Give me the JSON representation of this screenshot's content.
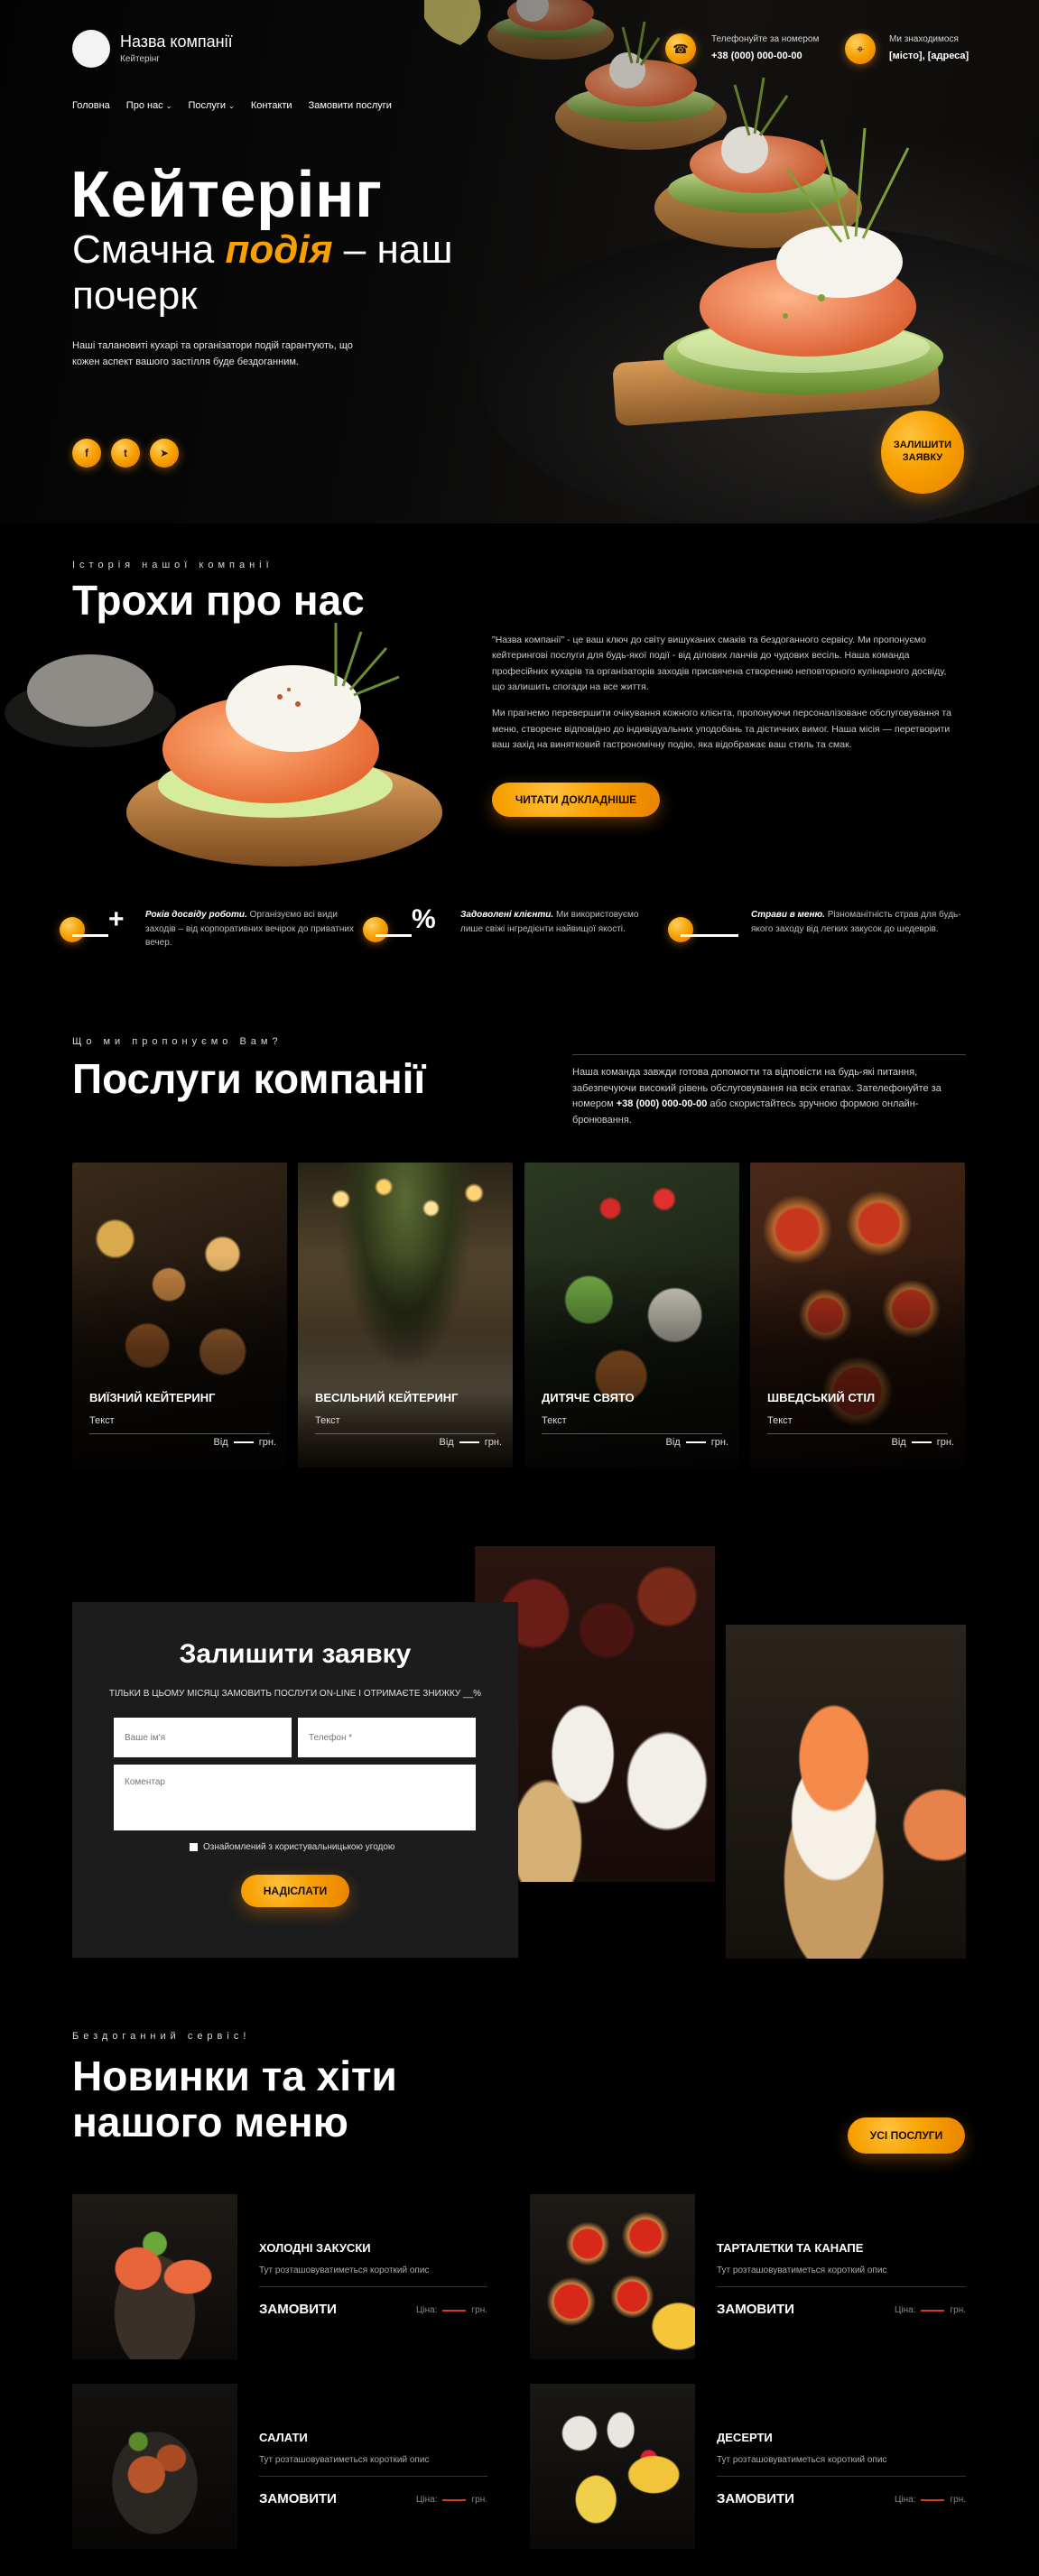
{
  "brand": {
    "name": "Назва компанії",
    "subtitle": "Кейтерінг"
  },
  "header": {
    "phone_label": "Телефонуйте за номером",
    "phone_value": "+38 (000) 000-00-00",
    "address_label": "Ми знаходимося",
    "address_value": "[місто], [адреса]"
  },
  "nav": {
    "items": [
      {
        "label": "Головна"
      },
      {
        "label": "Про нас",
        "dropdown": true
      },
      {
        "label": "Послуги",
        "dropdown": true
      },
      {
        "label": "Контакти"
      },
      {
        "label": "Замовити послуги"
      }
    ]
  },
  "hero": {
    "title": "Кейтерінг",
    "line1_before": "Смачна ",
    "line1_accent": "подія",
    "line1_after": " – наш",
    "line2": "почерк",
    "description": "Наші талановиті кухарі та організатори подій гарантують, що кожен аспект вашого застілля буде бездоганним.",
    "cta": "Залишити заявку",
    "socials": [
      {
        "icon": "facebook-icon",
        "glyph": "f"
      },
      {
        "icon": "twitter-icon",
        "glyph": "t"
      },
      {
        "icon": "telegram-icon",
        "glyph": "➤"
      }
    ]
  },
  "about": {
    "eyebrow": "Історія нашої компанії",
    "title": "Трохи про нас",
    "paragraph1": "\"Назва компанії\" - це ваш ключ до світу вишуканих смаків та бездоганного сервісу. Ми пропонуємо кейтерингові послуги для будь-якої події - від ділових ланчів до чудових весіль. Наша команда професійних кухарів та організаторів заходів присвячена створенню неповторного кулінарного досвіду, що залишить спогади на все життя.",
    "paragraph2": "Ми прагнемо перевершити очікування кожного клієнта, пропонуючи персоналізоване обслуговування та меню, створене відповідно до індивідуальних уподобань та дієтичних вимог. Наша місія — перетворити ваш захід на винятковий гастрономічну подію, яка відображає ваш стиль та смак.",
    "button": "Читати докладніше",
    "stats": [
      {
        "symbol": "+",
        "bold": "Років досвіду роботи.",
        "text": " Організуємо всі види заходів – від корпоративних вечірок до приватних вечер."
      },
      {
        "symbol": "%",
        "bold": "Задоволені клієнти.",
        "text": " Ми використовуємо лише свіжі інгредієнти найвищої якості."
      },
      {
        "symbol": "",
        "bold": "Страви в меню.",
        "text": " Різноманітність страв для будь-якого заходу від легких закусок до шедеврів."
      }
    ]
  },
  "services": {
    "eyebrow": "Що ми пропонуємо Вам?",
    "title": "Послуги компанії",
    "desc_before": "Наша команда завжди готова допомогти та відповісти на будь-які питання, забезпечуючи високий рівень обслуговування на всіх етапах. Зателефонуйте за номером ",
    "desc_phone": "+38 (000) 000-00-00",
    "desc_after": " або скористайтесь зручною формою онлайн-бронювання.",
    "cards": [
      {
        "title": "Виїзний кейтеринг",
        "text": "Текст",
        "price_from": "Від",
        "currency": "грн."
      },
      {
        "title": "Весільний кейтеринг",
        "text": "Текст",
        "price_from": "Від",
        "currency": "грн."
      },
      {
        "title": "Дитяче свято",
        "text": "Текст",
        "price_from": "Від",
        "currency": "грн."
      },
      {
        "title": "Шведський стіл",
        "text": "Текст",
        "price_from": "Від",
        "currency": "грн."
      }
    ]
  },
  "form": {
    "title": "Залишити заявку",
    "promo": "ТІЛЬКИ В ЦЬОМУ МІСЯЦІ ЗАМОВИТЬ ПОСЛУГИ ON-LINE І ОТРИМАЄТЕ ЗНИЖКУ __%",
    "name_placeholder": "Ваше ім'я",
    "phone_placeholder": "Телефон *",
    "comment_placeholder": "Коментар",
    "agree": "Ознайомлений з користувальницькою угодою",
    "submit": "Надіслати"
  },
  "menu": {
    "eyebrow": "Бездоганний сервіс!",
    "title_line1": "Новинки та хіти",
    "title_line2": "нашого меню",
    "all_button": "Усі послуги",
    "items": [
      {
        "title": "Холодні закуски",
        "desc": "Тут розташовуватиметься короткий опис",
        "order": "Замовити",
        "price_label": "Ціна:",
        "currency": "грн."
      },
      {
        "title": "Тарталетки та канапе",
        "desc": "Тут розташовуватиметься короткий опис",
        "order": "Замовити",
        "price_label": "Ціна:",
        "currency": "грн."
      },
      {
        "title": "Салати",
        "desc": "Тут розташовуватиметься короткий опис",
        "order": "Замовити",
        "price_label": "Ціна:",
        "currency": "грн."
      },
      {
        "title": "Десерти",
        "desc": "Тут розташовуватиметься короткий опис",
        "order": "Замовити",
        "price_label": "Ціна:",
        "currency": "грн."
      }
    ]
  },
  "colors": {
    "accent": "#f7a000",
    "background": "#000000",
    "panel": "#1c1c1c",
    "price_line": "#d43b2a"
  }
}
